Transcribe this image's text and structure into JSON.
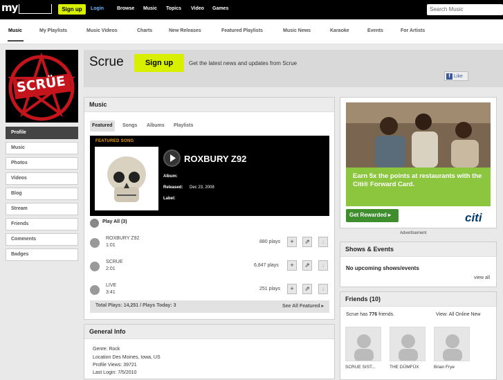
{
  "topbar": {
    "logo": "my",
    "signup": "Sign up",
    "login": "Login",
    "nav": [
      "Browse",
      "Music",
      "Topics",
      "Video",
      "Games"
    ],
    "search_placeholder": "Search Music"
  },
  "subnav": [
    "Music",
    "My Playlists",
    "Music Videos",
    "Charts",
    "New Releases",
    "Featured Playlists",
    "Music News",
    "Karaoke",
    "Events",
    "For Artists"
  ],
  "sidebar": {
    "items": [
      "Profile",
      "Music",
      "Photos",
      "Videos",
      "Blog",
      "Stream",
      "Friends",
      "Comments",
      "Badges"
    ]
  },
  "profile": {
    "name": "Scrue",
    "signup_label": "Sign up",
    "tagline": "Get the latest news and updates from Scrue",
    "like_label": "Like",
    "logo_text": "SCRÜE"
  },
  "music": {
    "heading": "Music",
    "tabs": [
      "Featured",
      "Songs",
      "Albums",
      "Playlists"
    ],
    "featured": {
      "label": "FEATURED SONG",
      "title": "ROXBURY Z92",
      "album_label": "Album:",
      "album_value": "",
      "released_label": "Released:",
      "released_value": "Dec 23, 2008",
      "label_label": "Label:",
      "label_value": ""
    },
    "play_all": "Play All (3)",
    "tracks": [
      {
        "name": "ROXBURY Z92",
        "duration": "1:01",
        "plays": "880 plays"
      },
      {
        "name": "SCRUE",
        "duration": "2:01",
        "plays": "6,847 plays"
      },
      {
        "name": "LIVE",
        "duration": "3:41",
        "plays": "251 plays"
      }
    ],
    "totals": "Total Plays: 14,251 / Plays Today: 3",
    "see_all": "See All Featured ▸"
  },
  "general_info": {
    "heading": "General Info",
    "genre": "Genre: Rock",
    "location": "Location Des Moines, Iowa, US",
    "profile_views": "Profile Views: 39721",
    "last_login": "Last Login: 7/5/2010"
  },
  "ad": {
    "headline": "Earn 5x the points at restaurants with the Citi® Forward Card.",
    "button": "Get Rewarded ▸",
    "brand": "citi",
    "label": "Advertisement"
  },
  "shows": {
    "heading": "Shows & Events",
    "empty": "No upcoming shows/events",
    "view_all": "view all"
  },
  "friends": {
    "heading": "Friends (10)",
    "count_prefix": "Scrue has ",
    "count": "776",
    "count_suffix": " friends.",
    "view_label": "View:",
    "view_all": "All",
    "view_online": "Online",
    "view_new": "New",
    "list": [
      "SCRUE SIST...",
      "THE DÜMFÜX",
      "Brian Frye"
    ]
  },
  "colors": {
    "accent": "#d8f000",
    "link": "#6bb6ff",
    "ad_green": "#8cc63f"
  }
}
